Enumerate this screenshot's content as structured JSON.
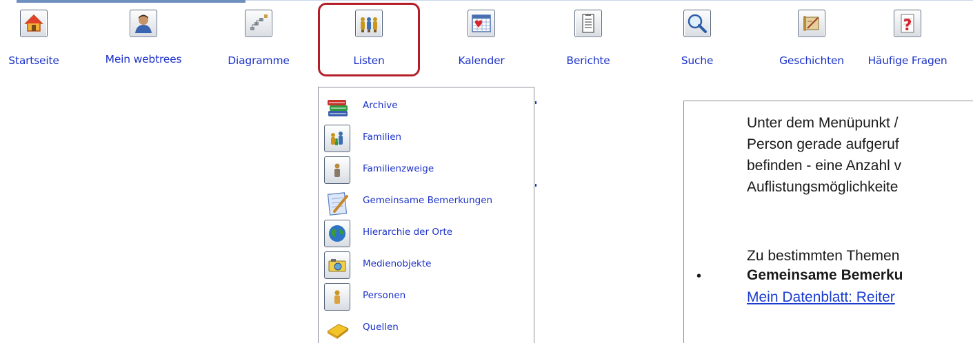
{
  "nav": {
    "items": [
      {
        "label": "Startseite",
        "icon": "home-icon"
      },
      {
        "label": "Mein webtrees",
        "icon": "user-icon"
      },
      {
        "label": "Diagramme",
        "icon": "chart-icon"
      },
      {
        "label": "Listen",
        "icon": "people-icon"
      },
      {
        "label": "Kalender",
        "icon": "calendar-icon"
      },
      {
        "label": "Berichte",
        "icon": "report-icon"
      },
      {
        "label": "Suche",
        "icon": "search-icon"
      },
      {
        "label": "Geschichten",
        "icon": "scroll-icon"
      },
      {
        "label": "Häufige Fragen",
        "icon": "question-icon"
      }
    ],
    "highlighted": "Listen",
    "highlight_color": "#b41e28",
    "link_color": "#1c32c8"
  },
  "dropdown": {
    "items": [
      {
        "label": "Archive",
        "icon": "books-icon"
      },
      {
        "label": "Familien",
        "icon": "family-icon"
      },
      {
        "label": "Familienzweige",
        "icon": "person-icon"
      },
      {
        "label": "Gemeinsame Bemerkungen",
        "icon": "note-icon"
      },
      {
        "label": "Hierarchie der Orte",
        "icon": "globe-icon"
      },
      {
        "label": "Medienobjekte",
        "icon": "camera-icon"
      },
      {
        "label": "Personen",
        "icon": "person-icon"
      },
      {
        "label": "Quellen",
        "icon": "book-icon"
      }
    ]
  },
  "content": {
    "lines": [
      "Unter dem Menüpunkt /",
      "Person gerade aufgeruf",
      "befinden - eine Anzahl v",
      "Auflistungsmöglichkeite"
    ],
    "line2": "Zu bestimmten Themen",
    "bullet_symbol": "•",
    "bullet_bold": "Gemeinsame Bemerku",
    "bullet_link": "Mein Datenblatt: Reiter"
  }
}
